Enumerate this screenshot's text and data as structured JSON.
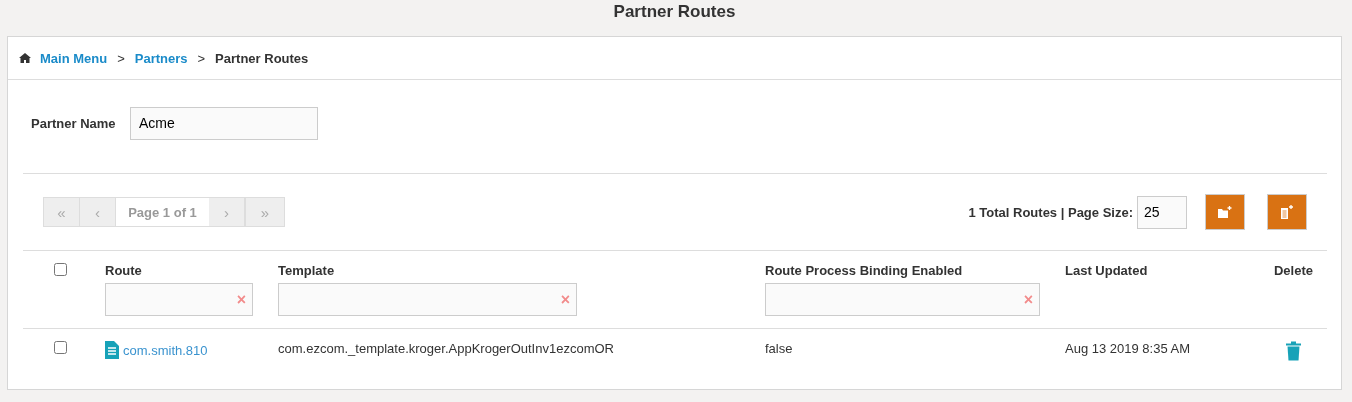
{
  "title": "Partner Routes",
  "breadcrumb": [
    {
      "label": "Main Menu",
      "link": true
    },
    {
      "label": "Partners",
      "link": true
    },
    {
      "label": "Partner Routes",
      "link": false
    }
  ],
  "breadcrumb_separator": ">",
  "partner_name": {
    "label": "Partner Name",
    "value": "Acme"
  },
  "pager": {
    "first": "«",
    "prev": "‹",
    "page": "Page 1 of 1",
    "next": "›",
    "last": "»"
  },
  "summary": "1 Total Routes | Page Size:",
  "page_size": "25",
  "table": {
    "select_all_checked": false,
    "columns": [
      {
        "label": "Route",
        "filter": true
      },
      {
        "label": "Template",
        "filter": true
      },
      {
        "label": "Route Process Binding Enabled",
        "filter": true
      },
      {
        "label": "Last Updated",
        "filter": false
      },
      {
        "label": "Delete",
        "filter": false
      }
    ],
    "clear_glyph": "×",
    "rows": [
      {
        "checked": false,
        "route": "com.smith.810",
        "template": "com.ezcom._template.kroger.AppKrogerOutInv1ezcomOR",
        "binding": "false",
        "last_updated": "Aug 13 2019 8:35 AM"
      }
    ]
  }
}
